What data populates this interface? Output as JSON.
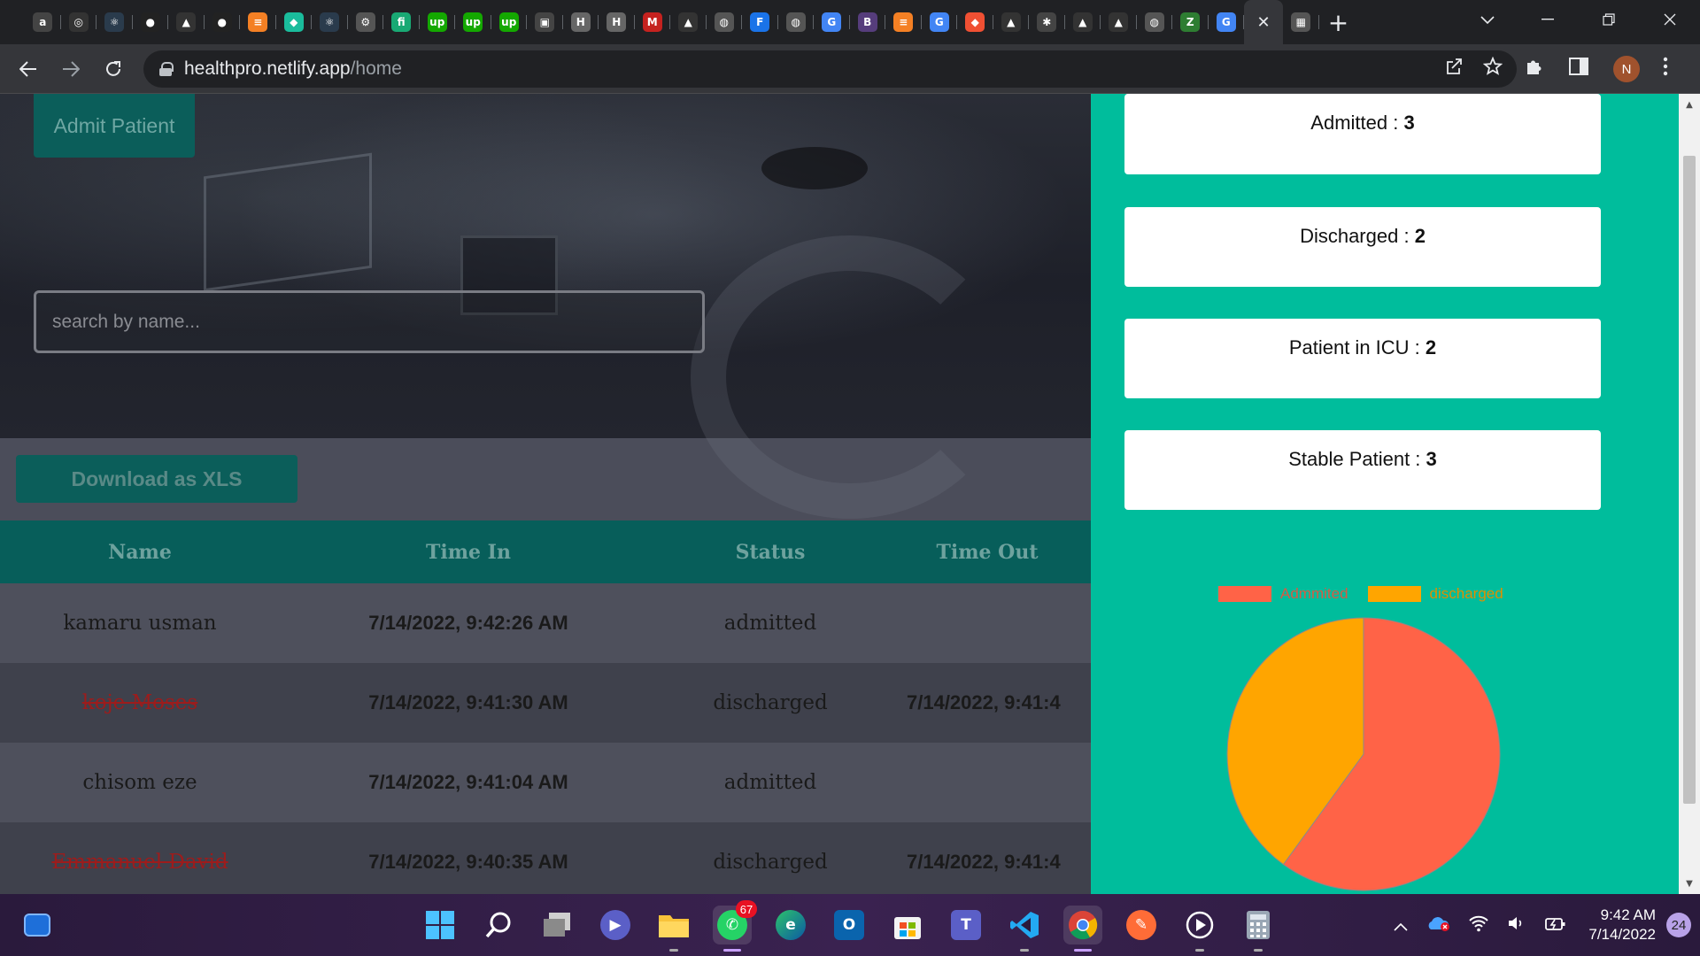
{
  "browser": {
    "tabs": [
      {
        "icon": "a",
        "color": "#444"
      },
      {
        "icon": "◎",
        "color": "#333"
      },
      {
        "icon": "⚛",
        "color": "#2a3b4c"
      },
      {
        "icon": "●",
        "color": "#222"
      },
      {
        "icon": "▲",
        "color": "#333"
      },
      {
        "icon": "●",
        "color": "#222"
      },
      {
        "icon": "≡",
        "color": "#f48024"
      },
      {
        "icon": "◆",
        "color": "#1abc9c"
      },
      {
        "icon": "⚛",
        "color": "#2a3b4c"
      },
      {
        "icon": "⚙",
        "color": "#555"
      },
      {
        "icon": "fi",
        "color": "#19a974"
      },
      {
        "icon": "up",
        "color": "#14a800"
      },
      {
        "icon": "up",
        "color": "#14a800"
      },
      {
        "icon": "up",
        "color": "#14a800"
      },
      {
        "icon": "▣",
        "color": "#444"
      },
      {
        "icon": "H",
        "color": "#666"
      },
      {
        "icon": "H",
        "color": "#666"
      },
      {
        "icon": "M",
        "color": "#c5221f"
      },
      {
        "icon": "▲",
        "color": "#333"
      },
      {
        "icon": "◍",
        "color": "#555"
      },
      {
        "icon": "F",
        "color": "#1a73e8"
      },
      {
        "icon": "◍",
        "color": "#555"
      },
      {
        "icon": "G",
        "color": "#4285f4"
      },
      {
        "icon": "B",
        "color": "#563d7c"
      },
      {
        "icon": "≡",
        "color": "#f48024"
      },
      {
        "icon": "G",
        "color": "#4285f4"
      },
      {
        "icon": "◆",
        "color": "#f05033"
      },
      {
        "icon": "▲",
        "color": "#333"
      },
      {
        "icon": "✱",
        "color": "#444"
      },
      {
        "icon": "▲",
        "color": "#333"
      },
      {
        "icon": "▲",
        "color": "#333"
      },
      {
        "icon": "◍",
        "color": "#555"
      },
      {
        "icon": "Z",
        "color": "#2e7d32"
      },
      {
        "icon": "G",
        "color": "#4285f4"
      }
    ],
    "active_tab_close": "✕",
    "new_tab": "+",
    "url_host": "healthpro.netlify.app",
    "url_path": "/home",
    "profile_initial": "N"
  },
  "app": {
    "admit_button": "Admit Patient",
    "search_placeholder": "search by name...",
    "download_button": "Download as XLS",
    "table": {
      "headers": [
        "Name",
        "Time In",
        "Status",
        "Time Out"
      ],
      "rows": [
        {
          "name": "kamaru usman",
          "time_in": "7/14/2022, 9:42:26 AM",
          "status": "admitted",
          "time_out": ""
        },
        {
          "name": "koje Moses",
          "time_in": "7/14/2022, 9:41:30 AM",
          "status": "discharged",
          "time_out": "7/14/2022, 9:41:4"
        },
        {
          "name": "chisom eze",
          "time_in": "7/14/2022, 9:41:04 AM",
          "status": "admitted",
          "time_out": ""
        },
        {
          "name": "Emmanuel David",
          "time_in": "7/14/2022, 9:40:35 AM",
          "status": "discharged",
          "time_out": "7/14/2022, 9:41:4"
        }
      ]
    },
    "stats": [
      {
        "label": "Admitted : ",
        "value": "3"
      },
      {
        "label": "Discharged : ",
        "value": "2"
      },
      {
        "label": "Patient in ICU : ",
        "value": "2"
      },
      {
        "label": "Stable Patient : ",
        "value": "3"
      }
    ]
  },
  "chart_data": {
    "type": "pie",
    "categories": [
      "Admmited",
      "discharged"
    ],
    "values": [
      3,
      2
    ],
    "colors": [
      "#ff6347",
      "#ffa500"
    ],
    "legend_position": "top"
  },
  "taskbar": {
    "whatsapp_badge": "67",
    "clock_time": "9:42 AM",
    "clock_date": "7/14/2022",
    "notification_count": "24"
  }
}
